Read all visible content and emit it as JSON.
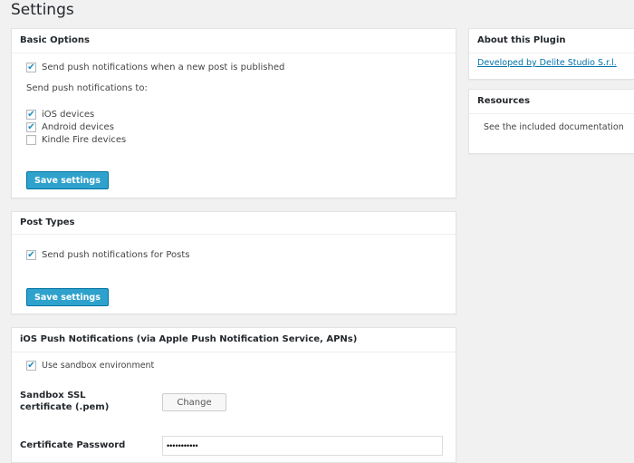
{
  "page_title": "Settings",
  "basic": {
    "title": "Basic Options",
    "publish_label": "Send push notifications when a new post is published",
    "publish_checked": true,
    "send_to_label": "Send push notifications to:",
    "devices": [
      {
        "label": "iOS devices",
        "checked": true
      },
      {
        "label": "Android devices",
        "checked": true
      },
      {
        "label": "Kindle Fire devices",
        "checked": false
      }
    ],
    "save_label": "Save settings"
  },
  "post_types": {
    "title": "Post Types",
    "posts_label": "Send push notifications for Posts",
    "posts_checked": true,
    "save_label": "Save settings"
  },
  "ios": {
    "title": "iOS Push Notifications (via Apple Push Notification Service, APNs)",
    "sandbox_label": "Use sandbox environment",
    "sandbox_checked": true,
    "cert_label": "Sandbox SSL certificate (.pem)",
    "change_label": "Change",
    "password_label": "Certificate Password",
    "password_value": "•••••••••••"
  },
  "about": {
    "title": "About this Plugin",
    "link": "Developed by Delite Studio S.r.l."
  },
  "resources": {
    "title": "Resources",
    "text": "See the included documentation"
  },
  "check_glyph": "✔"
}
